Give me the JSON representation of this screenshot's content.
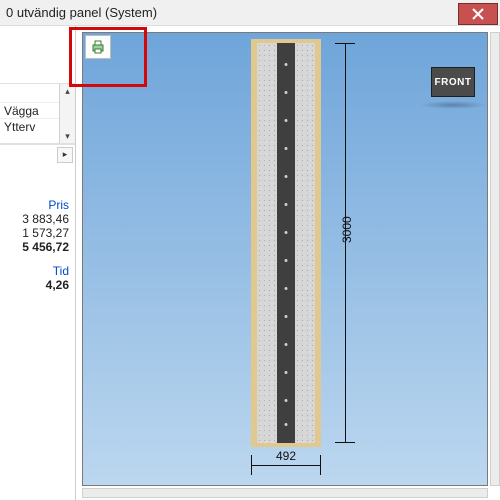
{
  "window": {
    "title": "0 utvändig panel (System)"
  },
  "left": {
    "grid": {
      "row1": "Vägga",
      "row2": "Ytterv"
    },
    "pris_label": "Pris",
    "pris_val1": "3 883,46",
    "pris_val2": "1 573,27",
    "pris_total": "5 456,72",
    "tid_label": "Tid",
    "tid_val": "4,26"
  },
  "viewport": {
    "cube_face": "FRONT",
    "dim_height": "3000",
    "dim_width": "492"
  }
}
